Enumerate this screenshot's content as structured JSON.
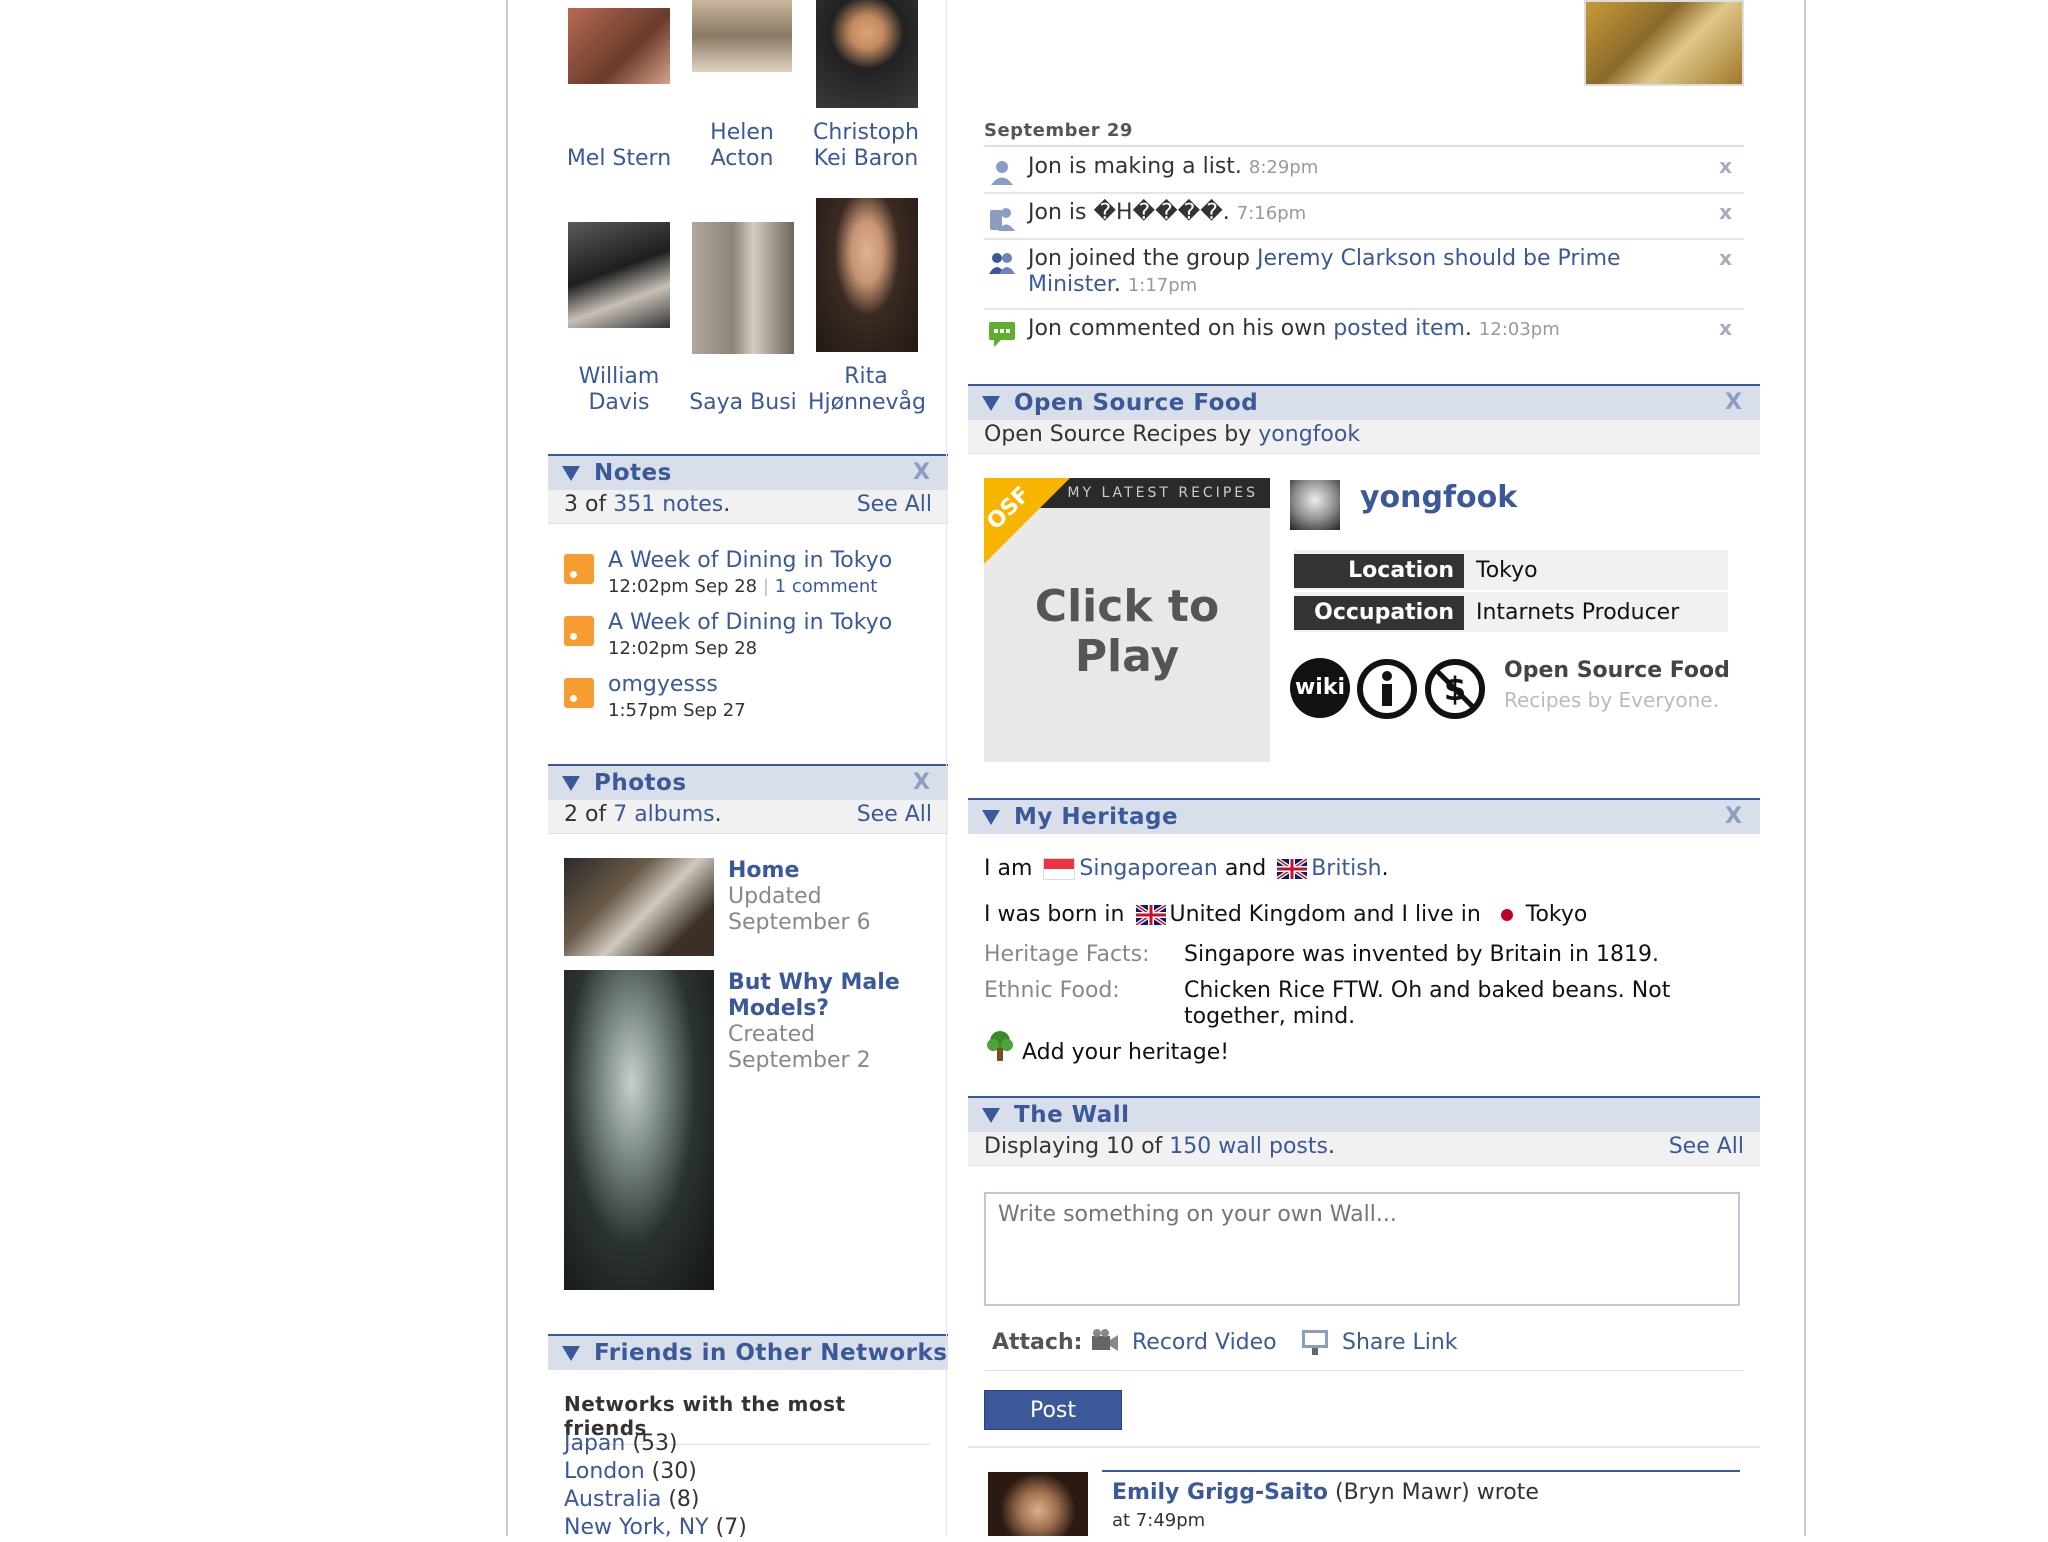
{
  "friends": [
    {
      "name": "Mel Stern"
    },
    {
      "name": "Helen Acton"
    },
    {
      "name": "Christoph Kei Baron"
    },
    {
      "name": "William Davis"
    },
    {
      "name": "Saya Busi"
    },
    {
      "name": "Rita Hjønnevåg"
    }
  ],
  "notes": {
    "title": "Notes",
    "summary_prefix": "3 of ",
    "summary_link": "351 notes",
    "summary_suffix": ".",
    "see_all": "See All",
    "items": [
      {
        "title": "A Week of Dining in Tokyo",
        "meta": "12:02pm Sep 28",
        "comment": "1 comment"
      },
      {
        "title": "A Week of Dining in Tokyo",
        "meta": "12:02pm Sep 28"
      },
      {
        "title": "omgyesss",
        "meta": "1:57pm Sep 27"
      }
    ]
  },
  "photos": {
    "title": "Photos",
    "summary_prefix": "2 of ",
    "summary_link": "7 albums",
    "summary_suffix": ".",
    "see_all": "See All",
    "albums": [
      {
        "name": "Home",
        "status": "Updated",
        "date": "September 6"
      },
      {
        "name": "But Why Male Models?",
        "status": "Created",
        "date": "September 2"
      }
    ]
  },
  "other_networks": {
    "title": "Friends in Other Networks",
    "subtitle": "Networks with the most friends",
    "items": [
      {
        "name": "Japan",
        "count": "(53)"
      },
      {
        "name": "London",
        "count": "(30)"
      },
      {
        "name": "Australia",
        "count": "(8)"
      },
      {
        "name": "New York, NY",
        "count": "(7)"
      }
    ]
  },
  "minifeed": {
    "date": "September 29",
    "items": [
      {
        "text": "Jon is making a list.",
        "time": "8:29pm"
      },
      {
        "text": "Jon is �H����.",
        "time": "7:16pm"
      },
      {
        "text_pre": "Jon joined the group ",
        "link": "Jeremy Clarkson should be Prime",
        "link2": "Minister",
        "text_post": ".",
        "time": "1:17pm"
      },
      {
        "text_pre": "Jon commented on his own ",
        "link": "posted item",
        "text_post": ".",
        "time": "12:03pm"
      }
    ]
  },
  "osf": {
    "title": "Open Source Food",
    "subtitle_prefix": "Open Source Recipes by ",
    "subtitle_link": "yongfook",
    "widget_banner": "MY LATEST RECIPES",
    "widget_badge": "OSF",
    "widget_play": "Click to Play",
    "username": "yongfook",
    "location_label": "Location",
    "location_value": "Tokyo",
    "occupation_label": "Occupation",
    "occupation_value": "Intarnets Producer",
    "cc_wiki": "wiki",
    "brand_title": "Open Source Food",
    "brand_tagline": "Recipes by Everyone."
  },
  "heritage": {
    "title": "My Heritage",
    "i_am": "I am",
    "nat1": "Singaporean",
    "and": "and",
    "nat2": "British",
    "period": ".",
    "born_prefix": "I was born in",
    "born_place": "United Kingdom and I live in",
    "live_place": "Tokyo",
    "facts_label": "Heritage Facts:",
    "facts_value": "Singapore was invented by Britain in 1819.",
    "food_label": "Ethnic Food:",
    "food_value_1": "Chicken Rice FTW. Oh and baked beans. Not",
    "food_value_2": "together, mind.",
    "add_link": "Add your heritage!"
  },
  "wall": {
    "title": "The Wall",
    "summary_prefix": "Displaying 10 of ",
    "summary_link": "150 wall posts",
    "summary_suffix": ".",
    "see_all": "See All",
    "placeholder": "Write something on your own Wall...",
    "attach_label": "Attach:",
    "record_video": "Record Video",
    "share_link": "Share Link",
    "post_button": "Post",
    "post_author": "Emily Grigg-Saito",
    "post_network": "(Bryn Mawr) wrote",
    "post_time": "at 7:49pm"
  },
  "colors": {
    "link": "#3b5998",
    "header_bg": "#d8dfea",
    "rss": "#f79c31",
    "osf_yellow": "#f7b500"
  }
}
